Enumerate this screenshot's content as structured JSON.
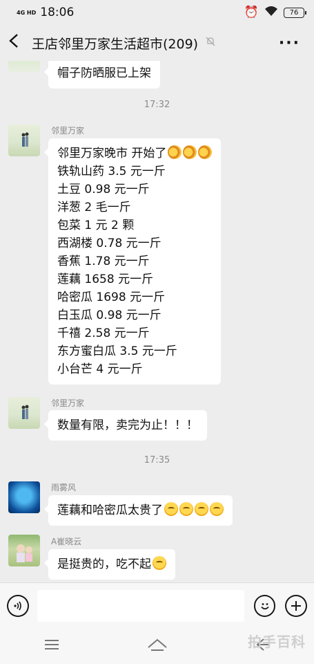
{
  "status": {
    "network": "4G HD",
    "time": "18:06",
    "battery": "76"
  },
  "header": {
    "title": "王店邻里万家生活超市(209)"
  },
  "messages": {
    "m0": {
      "text": "帽子防晒服已上架"
    },
    "t1": "17:32",
    "m1": {
      "sender": "邻里万家",
      "lines": [
        "邻里万家晚市 开始了",
        "铁轨山药 3.5 元一斤",
        "土豆 0.98 元一斤",
        "洋葱 2 毛一斤",
        "包菜 1 元 2 颗",
        "西湖楼 0.78 元一斤",
        "香蕉 1.78 元一斤",
        "莲藕 1658 元一斤",
        "哈密瓜 1698 元一斤",
        "白玉瓜 0.98 元一斤",
        "千禧 2.58 元一斤",
        "东方蜜白瓜 3.5 元一斤",
        "小台芒 4 元一斤"
      ]
    },
    "m2": {
      "sender": "邻里万家",
      "text": "数量有限，卖完为止！！！"
    },
    "t2": "17:35",
    "m3": {
      "sender": "雨雾风",
      "text": "莲藕和哈密瓜太贵了"
    },
    "m4": {
      "sender": "A崔晓云",
      "text": "是挺贵的，吃不起"
    }
  },
  "icons": {
    "back": "back-arrow-icon",
    "mute": "mute-bell-icon",
    "more": "more-icon",
    "voice": "voice-icon",
    "emoji": "emoji-icon",
    "plus": "plus-icon"
  },
  "watermark": "拍手百科"
}
